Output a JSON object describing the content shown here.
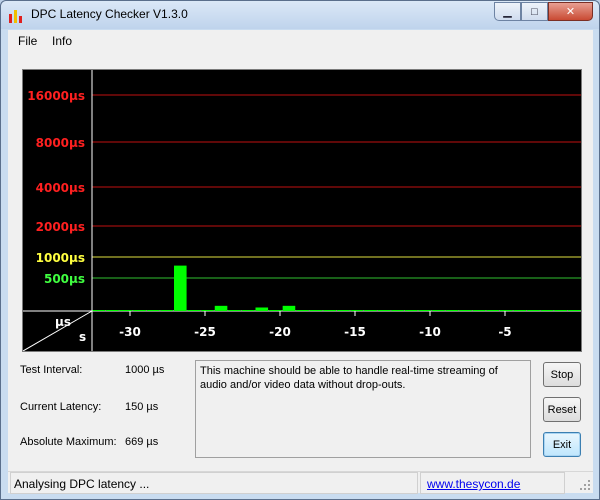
{
  "window": {
    "title": "DPC Latency Checker V1.3.0"
  },
  "menu": {
    "file": "File",
    "info": "Info"
  },
  "chart_data": {
    "type": "bar",
    "y_scale_labels": [
      "16000µs",
      "8000µs",
      "4000µs",
      "2000µs",
      "1000µs",
      "500µs"
    ],
    "y_label_colors": [
      "#ff2020",
      "#ff2020",
      "#ff2020",
      "#ff2020",
      "#ffff40",
      "#40ff40"
    ],
    "ylabel": "µs",
    "xlabel": "s",
    "x_ticks": [
      "-30",
      "-25",
      "-20",
      "-15",
      "-10",
      "-5"
    ],
    "values_us": [
      170,
      200,
      190,
      150,
      170,
      170,
      669,
      180,
      170,
      260,
      150,
      150,
      250,
      170,
      260,
      150,
      170,
      170,
      200,
      170,
      150,
      170,
      180,
      180,
      170,
      150,
      180,
      170,
      150,
      170,
      160,
      170,
      170,
      180,
      170,
      170
    ],
    "bar_color": "#00ff00"
  },
  "info": {
    "test_interval_label": "Test Interval:",
    "test_interval_value": "1000 µs",
    "current_latency_label": "Current Latency:",
    "current_latency_value": "150 µs",
    "absolute_max_label": "Absolute Maximum:",
    "absolute_max_value": "669 µs"
  },
  "message": "This machine should be able to handle real-time streaming of audio and/or video data without drop-outs.",
  "buttons": {
    "stop": "Stop",
    "reset": "Reset",
    "exit": "Exit"
  },
  "status": {
    "text": "Analysing DPC latency ...",
    "link": "www.thesycon.de"
  }
}
